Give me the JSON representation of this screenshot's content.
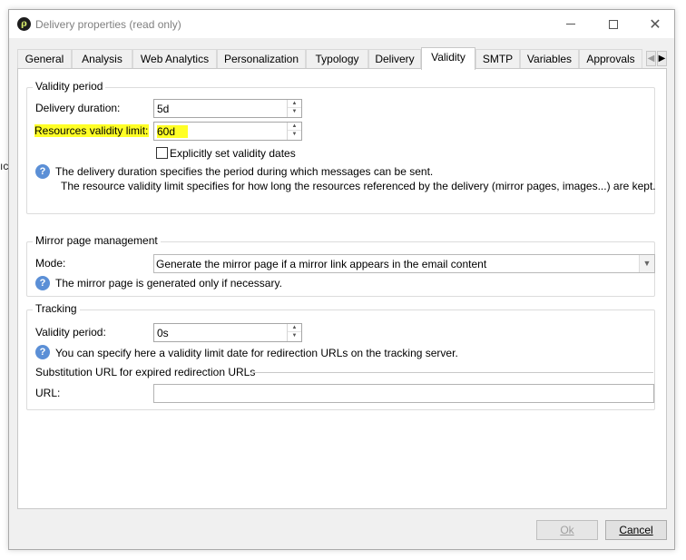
{
  "background_text": "ıc",
  "window": {
    "title": "Delivery properties (read only)",
    "app_icon_letter": "ρ"
  },
  "tabs": [
    {
      "label": "General",
      "active": false
    },
    {
      "label": "Analysis",
      "active": false
    },
    {
      "label": "Web Analytics",
      "active": false
    },
    {
      "label": "Personalization",
      "active": false
    },
    {
      "label": "Typology",
      "active": false
    },
    {
      "label": "Delivery",
      "active": false
    },
    {
      "label": "Validity",
      "active": true
    },
    {
      "label": "SMTP",
      "active": false
    },
    {
      "label": "Variables",
      "active": false
    },
    {
      "label": "Approvals",
      "active": false
    }
  ],
  "validity_period": {
    "title": "Validity period",
    "delivery_duration_label": "Delivery duration:",
    "delivery_duration_value": "5d",
    "resources_limit_label": "Resources validity limit:",
    "resources_limit_value": "60d",
    "explicit_dates_label": "Explicitly set validity dates",
    "explicit_dates_checked": false,
    "help_line1": "The delivery duration specifies the period during which messages can be sent.",
    "help_line2": "The resource validity limit specifies for how long the resources referenced by the delivery (mirror pages, images...) are kept."
  },
  "mirror_page": {
    "title": "Mirror page management",
    "mode_label": "Mode:",
    "mode_value": "Generate the mirror page if a mirror link appears in the email content",
    "help": "The mirror page is generated only if necessary."
  },
  "tracking": {
    "title": "Tracking",
    "validity_label": "Validity period:",
    "validity_value": "0s",
    "help": "You can specify here a validity limit date for redirection URLs on the tracking server.",
    "substitution_title": "Substitution URL for expired redirection URLs",
    "url_label": "URL:",
    "url_value": ""
  },
  "buttons": {
    "ok_label": "Ok",
    "ok_enabled": false,
    "cancel_label": "Cancel"
  },
  "colors": {
    "highlight": "#ffff26",
    "help_icon": "#5b8fd6"
  }
}
